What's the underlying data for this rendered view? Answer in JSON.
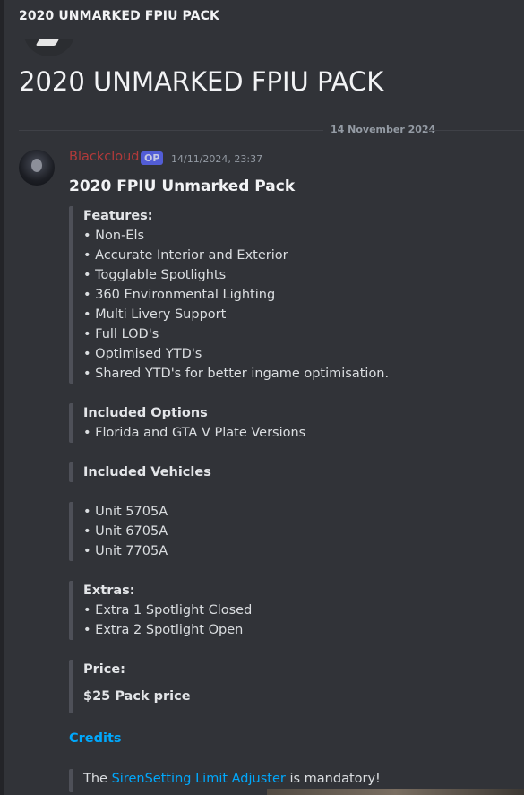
{
  "header": {
    "title": "2020 UNMARKED FPIU PACK"
  },
  "thread": {
    "title": "2020 UNMARKED FPIU PACK",
    "date_divider": "14 November 2024"
  },
  "message": {
    "author": "Blackcloud",
    "badge": "OP",
    "timestamp": "14/11/2024, 23:37",
    "title": "2020 FPIU Unmarked Pack",
    "features": {
      "heading": "Features:",
      "items": [
        "• Non-Els",
        "• Accurate Interior and Exterior",
        "• Togglable Spotlights",
        "• 360 Environmental Lighting",
        "• Multi Livery Support",
        "• Full LOD's",
        "• Optimised YTD's",
        "• Shared YTD's for better ingame optimisation."
      ]
    },
    "included_options": {
      "heading": "Included Options",
      "items": [
        "• Florida and GTA V Plate Versions"
      ]
    },
    "included_vehicles": {
      "heading": "Included Vehicles"
    },
    "vehicles": {
      "items": [
        "• Unit  5705A",
        "• Unit  6705A",
        "• Unit  7705A"
      ]
    },
    "extras": {
      "heading": "Extras:",
      "items": [
        "• Extra 1 Spotlight Closed",
        "• Extra 2 Spotlight Open"
      ]
    },
    "price": {
      "heading": "Price:",
      "value": "$25 Pack price"
    },
    "credits": "Credits",
    "notice": {
      "prefix": "The ",
      "link": "SirenSetting Limit Adjuster",
      "suffix": " is mandatory!"
    }
  },
  "colors": {
    "background": "#313338",
    "username": "#b23a3a",
    "link": "#00a8fc",
    "badge": "#5865f2",
    "quote_bar": "#4e5058"
  }
}
